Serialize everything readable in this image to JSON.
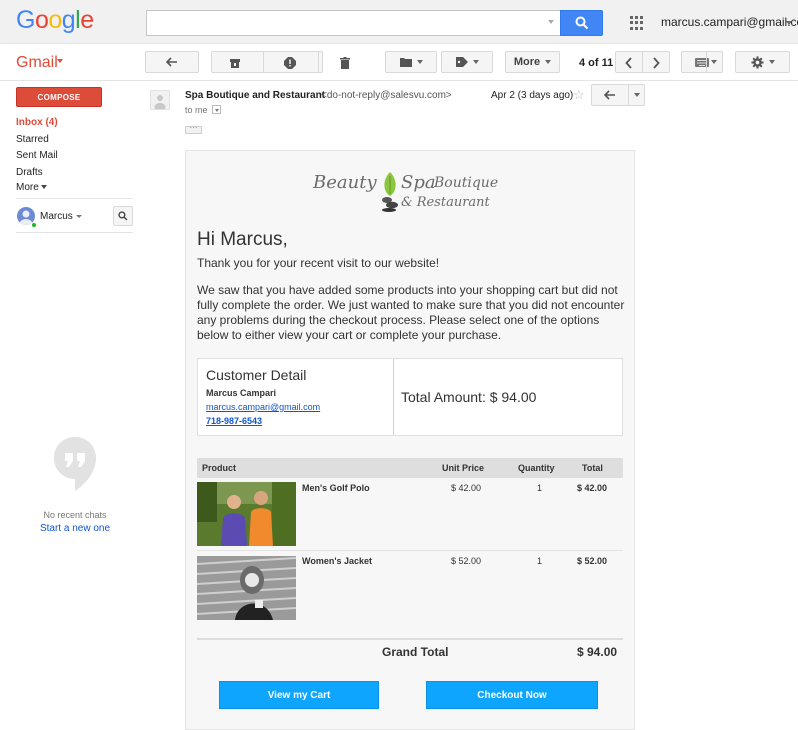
{
  "header": {
    "logo_text": "Google",
    "account_email": "marcus.campari@gmail.com",
    "search_value": ""
  },
  "toolbar": {
    "gmail_label": "Gmail",
    "more_label": "More",
    "page_count": "4 of 11"
  },
  "nav": {
    "compose_label": "COMPOSE",
    "items": [
      {
        "label": "Inbox (4)"
      },
      {
        "label": "Starred"
      },
      {
        "label": "Sent Mail"
      },
      {
        "label": "Drafts"
      }
    ],
    "more_label": "More"
  },
  "chat": {
    "user_name": "Marcus",
    "no_chats": "No recent chats",
    "start_new": "Start a new one"
  },
  "message": {
    "sender_name": "Spa Boutique and Restaurant",
    "sender_email": "<do-not-reply@salesvu.com>",
    "to": "to me",
    "date": "Apr 2 (3 days ago)",
    "ellipsis": "···"
  },
  "email": {
    "brand": {
      "word1": "Beauty",
      "word2": "Spa",
      "word3": "Boutique",
      "line2": "& Restaurant"
    },
    "greeting": "Hi Marcus,",
    "para1": "Thank you for your recent visit to our website!",
    "para2": "We saw that you have added some products into your shopping cart but did not fully complete the order. We just wanted to make sure that you did not encounter any problems during the checkout process. Please select one of the options below to either view your cart or complete your purchase.",
    "customer": {
      "title": "Customer Detail",
      "name": "Marcus Campari",
      "email": "marcus.campari@gmail.com",
      "phone": "718-987-6543",
      "total_label": "Total Amount: $ 94.00"
    },
    "table": {
      "headers": {
        "product": "Product",
        "unit_price": "Unit Price",
        "quantity": "Quantity",
        "total": "Total"
      },
      "rows": [
        {
          "name": "Men's Golf Polo",
          "unit_price": "$ 42.00",
          "quantity": "1",
          "total": "$ 42.00"
        },
        {
          "name": "Women's Jacket",
          "unit_price": "$ 52.00",
          "quantity": "1",
          "total": "$ 52.00"
        }
      ],
      "grand_total_label": "Grand Total",
      "grand_total_value": "$ 94.00"
    },
    "buttons": {
      "view_cart": "View my Cart",
      "checkout": "Checkout Now"
    }
  },
  "colors": {
    "google_blue": "#4285f4",
    "gmail_red": "#dd4b39",
    "link_blue": "#1155cc",
    "cta_blue": "#0ea5ff",
    "brand_green": "#8cc63f"
  },
  "icons": [
    "apps-grid-icon",
    "search-icon",
    "reply-icon",
    "archive-icon",
    "report-spam-icon",
    "delete-icon",
    "folder-icon",
    "label-icon",
    "chevron-left-icon",
    "chevron-right-icon",
    "keyboard-icon",
    "gear-icon",
    "star-icon",
    "hangouts-icon",
    "avatar-icon"
  ]
}
